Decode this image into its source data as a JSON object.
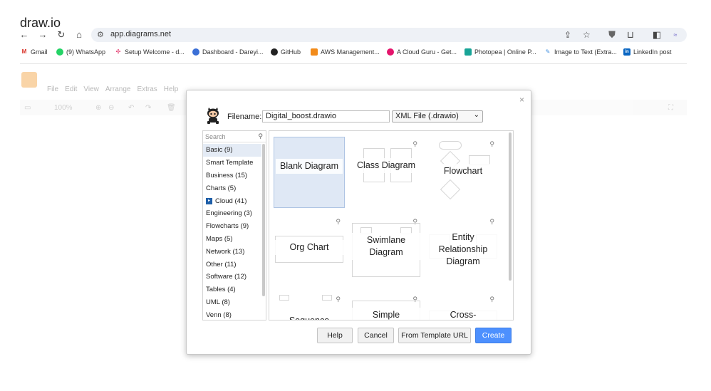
{
  "page": {
    "heading": "draw.io"
  },
  "browser": {
    "url": "app.diagrams.net",
    "nav": {
      "back": "←",
      "forward": "→",
      "reload": "↻",
      "home": "⌂"
    },
    "bookmarks": [
      {
        "label": "Gmail",
        "icon": "gmail-icon",
        "color": "#d93025",
        "glyph": "M"
      },
      {
        "label": "(9) WhatsApp",
        "icon": "whatsapp-icon",
        "color": "#25d366",
        "glyph": "✆"
      },
      {
        "label": "Setup Welcome - d...",
        "icon": "slack-icon",
        "color": "#4a154b",
        "glyph": "#"
      },
      {
        "label": "Dashboard - Dareyi...",
        "icon": "dareyio-icon",
        "color": "#3b6fd6",
        "glyph": "d"
      },
      {
        "label": "GitHub",
        "icon": "github-icon",
        "color": "#222222",
        "glyph": "●"
      },
      {
        "label": "AWS Management...",
        "icon": "aws-icon",
        "color": "#f28b1a",
        "glyph": "◆"
      },
      {
        "label": "A Cloud Guru - Get...",
        "icon": "acloudguru-icon",
        "color": "#e4156c",
        "glyph": "▶"
      },
      {
        "label": "Photopea | Online P...",
        "icon": "photopea-icon",
        "color": "#18a497",
        "glyph": "p"
      },
      {
        "label": "Image to Text (Extra...",
        "icon": "image-to-text-icon",
        "color": "#3f8fe0",
        "glyph": "✎"
      },
      {
        "label": "LinkedIn post",
        "icon": "linkedin-icon",
        "color": "#0a66c2",
        "glyph": "in"
      }
    ]
  },
  "app": {
    "menu": [
      "File",
      "Edit",
      "View",
      "Arrange",
      "Extras",
      "Help"
    ],
    "toolbar": {
      "zoom": "100%"
    }
  },
  "dialog": {
    "close": "×",
    "filename_label": "Filename:",
    "filename_value": "Digital_boost.drawio",
    "format_value": "XML File (.drawio)",
    "search_placeholder": "Search",
    "categories": [
      {
        "label": "Basic (9)",
        "selected": true
      },
      {
        "label": "Smart Template"
      },
      {
        "label": "Business (15)"
      },
      {
        "label": "Charts (5)"
      },
      {
        "label": "Cloud (41)",
        "icon": "cloud-icon"
      },
      {
        "label": "Engineering (3)"
      },
      {
        "label": "Flowcharts (9)"
      },
      {
        "label": "Maps (5)"
      },
      {
        "label": "Network (13)"
      },
      {
        "label": "Other (11)"
      },
      {
        "label": "Software (12)"
      },
      {
        "label": "Tables (4)"
      },
      {
        "label": "UML (8)"
      },
      {
        "label": "Venn (8)"
      }
    ],
    "templates": [
      {
        "label": "Blank Diagram",
        "selected": true
      },
      {
        "label": "Class Diagram"
      },
      {
        "label": "Flowchart"
      },
      {
        "label": "Org Chart"
      },
      {
        "label": "Swimlane Diagram"
      },
      {
        "label": "Entity Relationship Diagram"
      },
      {
        "label": "Sequence"
      },
      {
        "label": "Simple"
      },
      {
        "label": "Cross-"
      }
    ],
    "buttons": {
      "help": "Help",
      "cancel": "Cancel",
      "template_url": "From Template URL",
      "create": "Create"
    },
    "accent_color": "#4d90fe"
  }
}
